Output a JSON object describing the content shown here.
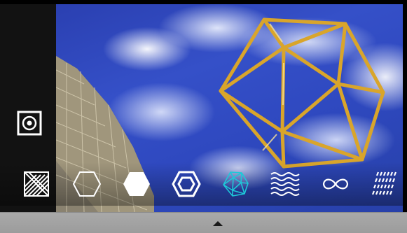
{
  "app": {
    "colors": {
      "accent": "#1ec8d8",
      "gold": "#d9a52b",
      "icon_white": "#ffffff",
      "panel_gray": "#a4a4a4"
    }
  },
  "side_control": {
    "icon": "target-icon"
  },
  "shape_toolbar": {
    "selected_index": 4,
    "items": [
      {
        "icon": "diagonal-stripes-icon"
      },
      {
        "icon": "hexagon-outline-icon"
      },
      {
        "icon": "hexagon-filled-icon"
      },
      {
        "icon": "hexagon-double-icon"
      },
      {
        "icon": "polyhedron-icon"
      },
      {
        "icon": "waves-icon"
      },
      {
        "icon": "infinity-icon"
      },
      {
        "icon": "dashes-icon"
      }
    ]
  },
  "bottom_panel": {
    "handle_icon": "triangle-up-icon"
  }
}
